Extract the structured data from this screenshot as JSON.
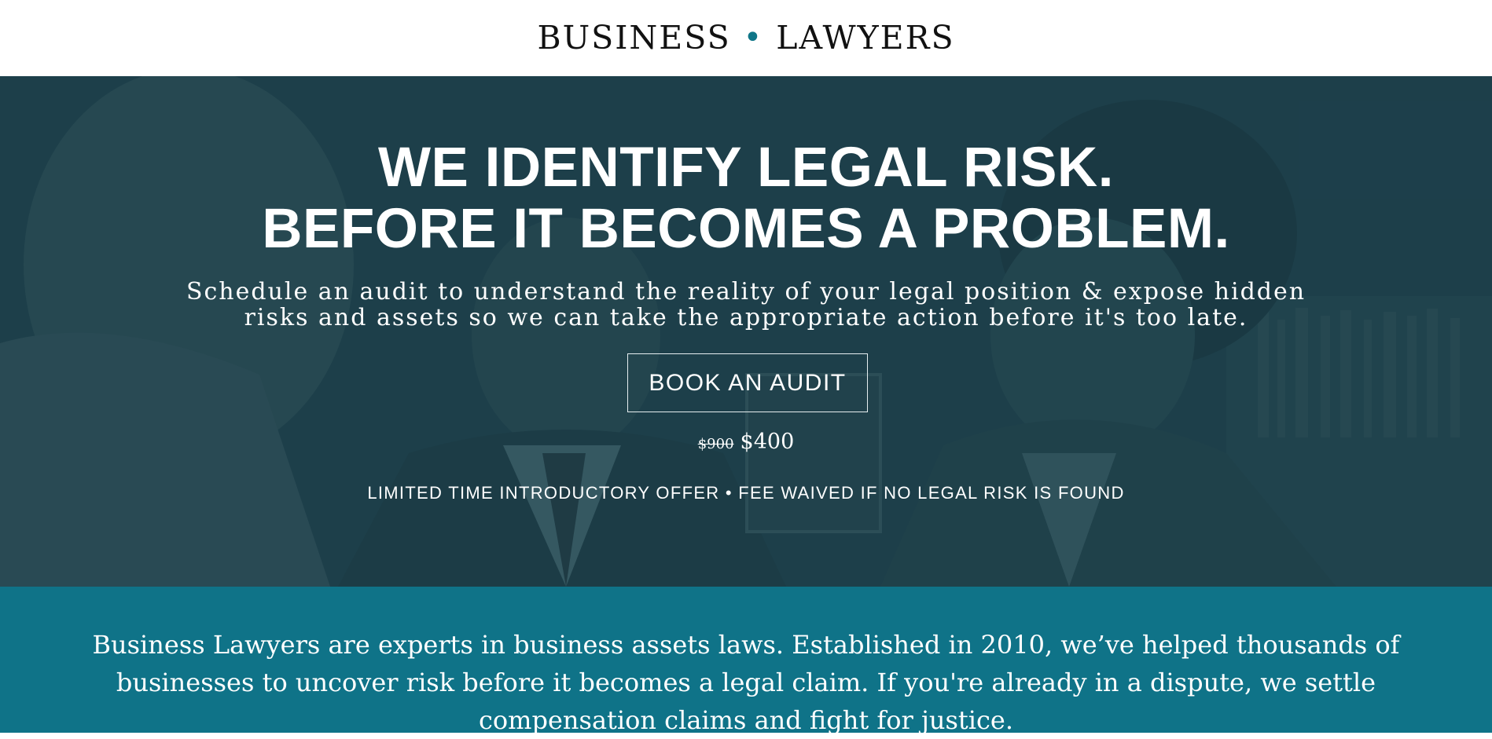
{
  "header": {
    "logo_left": "BUSINESS",
    "logo_separator": "•",
    "logo_right": "LAWYERS",
    "accent_color": "#0f7688"
  },
  "hero": {
    "headline_line1": "WE IDENTIFY LEGAL RISK.",
    "headline_line2": "BEFORE IT BECOMES A PROBLEM.",
    "subline_line1": "Schedule an audit to understand the reality of your legal position & expose hidden",
    "subline_line2": "risks and assets so we can take the appropriate action before it's too late.",
    "cta_label": "BOOK AN AUDIT",
    "price_old": "$900",
    "price_new": "$400",
    "offer_text": "LIMITED TIME INTRODUCTORY OFFER • FEE WAIVED IF NO LEGAL RISK IS FOUND",
    "overlay_color": "#1f3d47"
  },
  "about": {
    "text": "Business Lawyers are experts in business assets laws. Established in 2010, we’ve helped thousands of businesses to uncover risk before it becomes a legal claim. If you're already in a dispute, we settle compensation claims and fight for justice.",
    "background_color": "#0f7388"
  }
}
